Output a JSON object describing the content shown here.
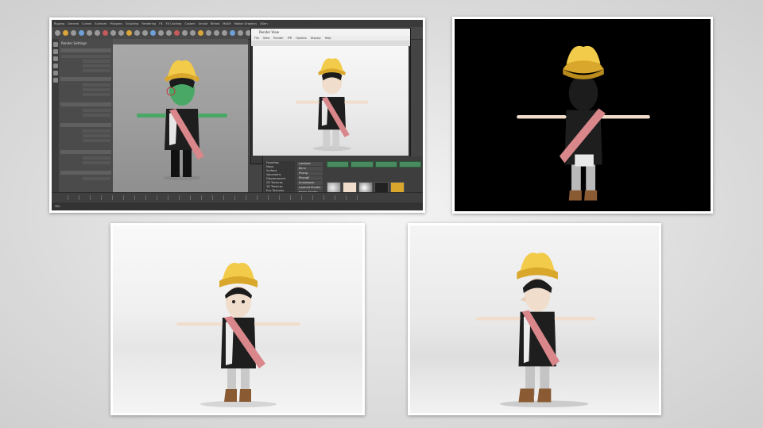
{
  "maya_window": {
    "menu_items": [
      "Rigging",
      "General",
      "Curves",
      "Surfaces",
      "Polygons",
      "Sculpting",
      "Rendering",
      "FX",
      "FX Caching",
      "Custom",
      "Arnold",
      "Bifrost",
      "MASH",
      "Motion Graphics",
      "XGen"
    ],
    "attribute_editor_title": "Render Settings",
    "render_view_title": "Render View",
    "render_view_menu": [
      "File",
      "View",
      "Render",
      "IPR",
      "Options",
      "Display",
      "Help"
    ],
    "render_status": "Frame: 1  Render Time: 0:08",
    "hypershade_list": [
      "Favorites",
      "Maya",
      "Surface",
      "Volumetric",
      "Displacement",
      "2D Textures",
      "3D Textures",
      "Env Textures",
      "Other Textures",
      "Lights",
      "Utilities"
    ],
    "hypershade_materials": [
      "Lambert",
      "Blinn",
      "Phong",
      "PhongE",
      "Anisotropic",
      "Layered Shader",
      "Ramp Shader"
    ],
    "command_line": "MEL"
  },
  "colors": {
    "hat": "#d9a72b",
    "hat_highlight": "#f2cb4a",
    "sash": "#d9878a",
    "skin": "#f1ddcb",
    "hair": "#1c1c1c",
    "shirt": "#1e1e1e",
    "pants": "#bdbdbd",
    "boots": "#8a5a33",
    "selection_green": "#4aa867"
  }
}
